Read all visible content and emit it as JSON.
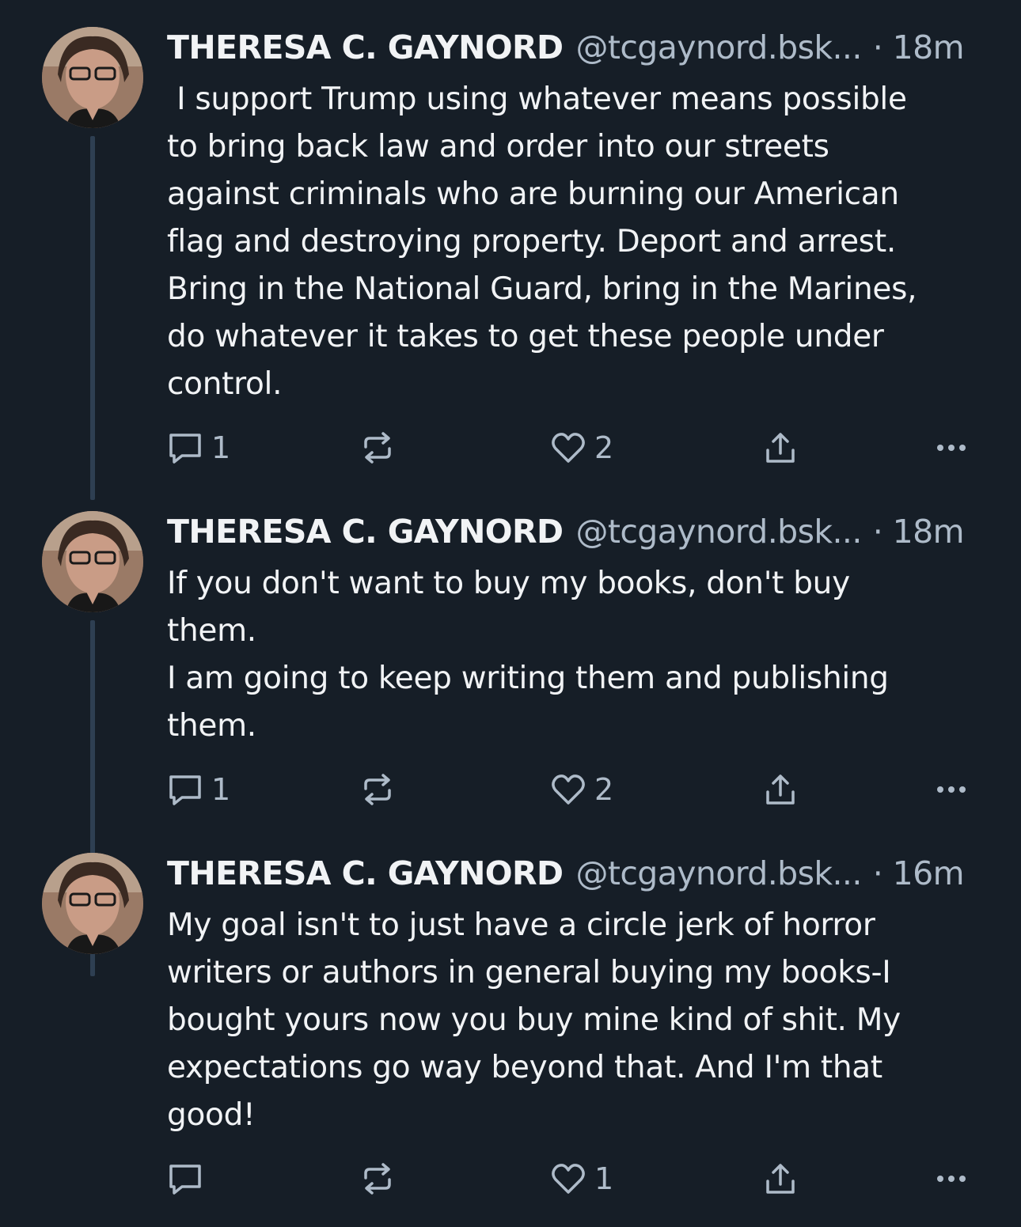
{
  "posts": [
    {
      "author": "THERESA C. GAYNORD",
      "handle": "@tcgaynord.bsk...",
      "time": "· 18m",
      "text": " I support Trump using whatever means possible\nto bring back law and order into our streets\nagainst criminals who are burning our American\nflag and destroying property. Deport and arrest.\nBring in the National Guard, bring in the Marines,\ndo whatever it takes to get these people under\ncontrol.",
      "replies": "1",
      "reposts": "",
      "likes": "2"
    },
    {
      "author": "THERESA C. GAYNORD",
      "handle": "@tcgaynord.bsk...",
      "time": "· 18m",
      "text": "If you don't want to buy my books, don't buy\nthem.\nI am going to keep writing them and publishing\nthem.",
      "replies": "1",
      "reposts": "",
      "likes": "2"
    },
    {
      "author": "THERESA C. GAYNORD",
      "handle": "@tcgaynord.bsk...",
      "time": "· 16m",
      "text": "My goal isn't to just have a circle jerk of horror\nwriters or authors in general buying my books-I\nbought yours now you buy mine kind of shit. My\nexpectations go way beyond that. And I'm that\ngood!",
      "replies": "",
      "reposts": "",
      "likes": "1"
    }
  ],
  "icons": {
    "reply": "speech-bubble-icon",
    "repost": "repost-arrows-icon",
    "like": "heart-icon",
    "share": "share-upload-icon",
    "more": "ellipsis-icon"
  },
  "colors": {
    "background": "#161e27",
    "text": "#f1f3f5",
    "muted": "#aebbc9",
    "thread_line": "#2e3f52"
  }
}
